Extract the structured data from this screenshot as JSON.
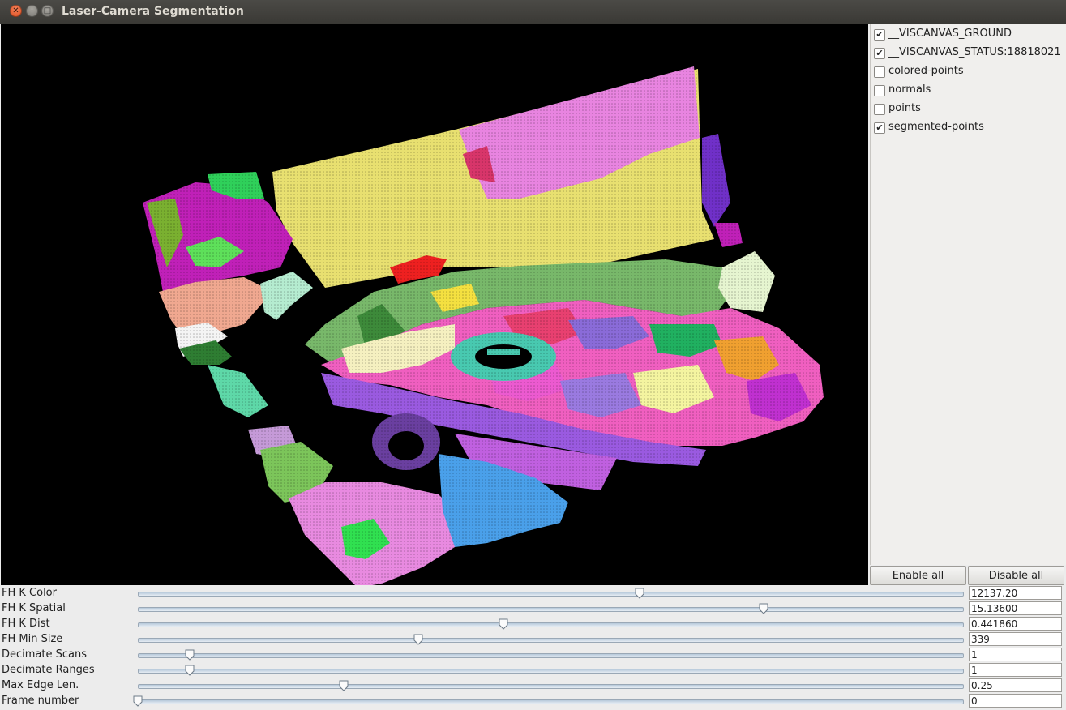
{
  "window": {
    "title": "Laser-Camera Segmentation"
  },
  "layers": [
    {
      "label": "__VISCANVAS_GROUND",
      "checked": true
    },
    {
      "label": "__VISCANVAS_STATUS:18818021",
      "checked": true
    },
    {
      "label": "colored-points",
      "checked": false
    },
    {
      "label": "normals",
      "checked": false
    },
    {
      "label": "points",
      "checked": false
    },
    {
      "label": "segmented-points",
      "checked": true
    }
  ],
  "buttons": {
    "enable_all": "Enable all",
    "disable_all": "Disable all"
  },
  "sliders": [
    {
      "label": "FH K Color",
      "value": "12137.20",
      "fraction": 0.609
    },
    {
      "label": "FH K Spatial",
      "value": "15.13600",
      "fraction": 0.759
    },
    {
      "label": "FH K Dist",
      "value": "0.441860",
      "fraction": 0.443
    },
    {
      "label": "FH Min Size",
      "value": "339",
      "fraction": 0.34
    },
    {
      "label": "Decimate Scans",
      "value": "1",
      "fraction": 0.063
    },
    {
      "label": "Decimate Ranges",
      "value": "1",
      "fraction": 0.063
    },
    {
      "label": "Max Edge Len.",
      "value": "0.25",
      "fraction": 0.25
    },
    {
      "label": "Frame number",
      "value": "0",
      "fraction": 0.0
    }
  ],
  "colors": {
    "canvas_bg": "#000000",
    "panel_bg": "#f0efed"
  }
}
